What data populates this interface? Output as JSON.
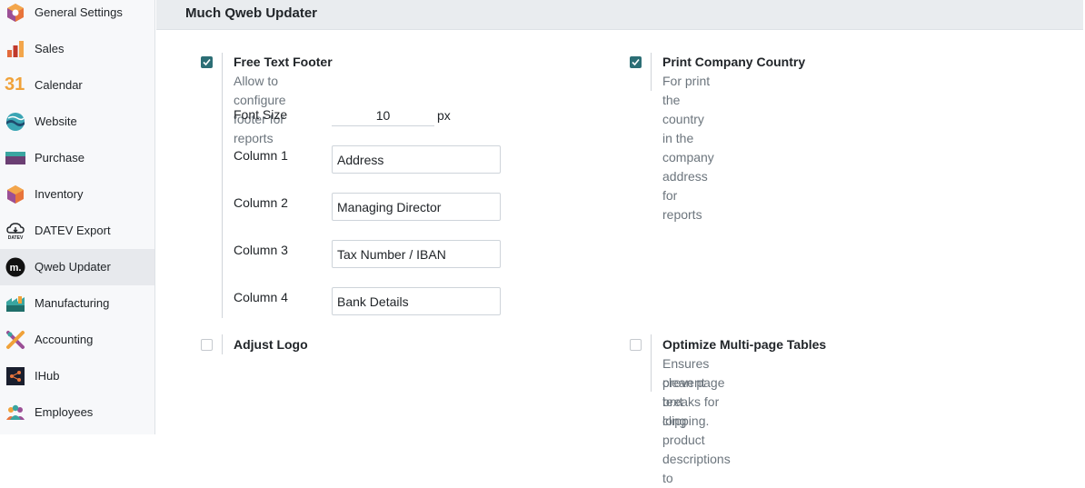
{
  "sidebar": {
    "items": [
      {
        "label": "General Settings",
        "icon": "general-settings-icon"
      },
      {
        "label": "Sales",
        "icon": "sales-icon"
      },
      {
        "label": "Calendar",
        "icon": "calendar-icon",
        "icon_text": "31"
      },
      {
        "label": "Website",
        "icon": "website-icon"
      },
      {
        "label": "Purchase",
        "icon": "purchase-icon"
      },
      {
        "label": "Inventory",
        "icon": "inventory-icon"
      },
      {
        "label": "DATEV Export",
        "icon": "datev-icon",
        "icon_text": "DATEV"
      },
      {
        "label": "Qweb Updater",
        "icon": "qweb-updater-icon",
        "icon_text": "m.",
        "active": true
      },
      {
        "label": "Manufacturing",
        "icon": "manufacturing-icon"
      },
      {
        "label": "Accounting",
        "icon": "accounting-icon"
      },
      {
        "label": "IHub",
        "icon": "ihub-icon"
      },
      {
        "label": "Employees",
        "icon": "employees-icon"
      }
    ]
  },
  "section": {
    "title": "Much Qweb Updater"
  },
  "settings": {
    "free_text_footer": {
      "title": "Free Text Footer",
      "description": "Allow to configure footer for reports",
      "checked": true,
      "font_size_label": "Font Size",
      "font_size_value": "10",
      "font_size_unit": "px",
      "columns": [
        {
          "label": "Column 1",
          "value": "Address"
        },
        {
          "label": "Column 2",
          "value": "Managing Director"
        },
        {
          "label": "Column 3",
          "value": "Tax Number / IBAN"
        },
        {
          "label": "Column 4",
          "value": "Bank Details"
        }
      ]
    },
    "print_company_country": {
      "title": "Print Company Country",
      "description": "For print the country in the company address for reports",
      "checked": true
    },
    "adjust_logo": {
      "title": "Adjust Logo",
      "checked": false
    },
    "optimize_tables": {
      "title": "Optimize Multi-page Tables",
      "description_line1": "Ensures clean page breaks for long product descriptions to",
      "description_line2": "prevent text clipping.",
      "checked": false
    }
  },
  "colors": {
    "accent": "#2c6e75",
    "sidebar_bg": "#f7f8fa",
    "active_item_bg": "#e7e9ed",
    "section_header_bg": "#e9ecef"
  }
}
